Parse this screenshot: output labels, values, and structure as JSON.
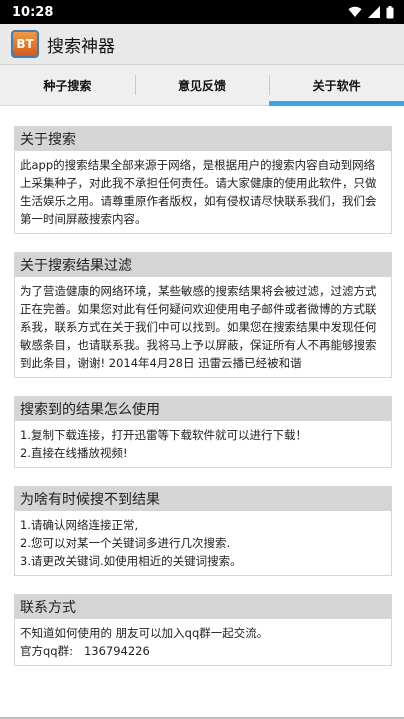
{
  "status_bar": {
    "time": "10:28"
  },
  "app_bar": {
    "icon_text": "BT",
    "title": "搜索神器"
  },
  "tabs": [
    {
      "label": "种子搜索",
      "active": false
    },
    {
      "label": "意见反馈",
      "active": false
    },
    {
      "label": "关于软件",
      "active": true
    }
  ],
  "accent_color": "#35a7e6",
  "sections": [
    {
      "title": "关于搜索",
      "body": "此app的搜索结果全部来源于网络，是根据用户的搜索内容自动到网络上采集种子，对此我不承担任何责任。请大家健康的使用此软件，只做生活娱乐之用。请尊重原作者版权，如有侵权请尽快联系我们，我们会第一时间屏蔽搜索内容。"
    },
    {
      "title": "关于搜索结果过滤",
      "body": "为了营造健康的网络环境，某些敏感的搜索结果将会被过滤，过滤方式正在完善。如果您对此有任何疑问欢迎使用电子邮件或者微博的方式联系我，联系方式在关于我们中可以找到。如果您在搜索结果中发现任何敏感条目，也请联系我。我将马上予以屏蔽，保证所有人不再能够搜索到此条目，谢谢! 2014年4月28日 迅雷云播已经被和谐"
    },
    {
      "title": "搜索到的结果怎么使用",
      "lines": [
        "1.复制下载连接，打开迅雷等下载软件就可以进行下载！",
        "2.直接在线播放视频!"
      ]
    },
    {
      "title": "为啥有时候搜不到结果",
      "lines": [
        "1.请确认网络连接正常,",
        "2.您可以对某一个关键词多进行几次搜索.",
        "3.请更改关键词.如使用相近的关键词搜索。"
      ]
    },
    {
      "title": "联系方式",
      "lines": [
        "不知道如何使用的 朋友可以加入qq群一起交流。",
        "官方qq群:   136794226"
      ]
    }
  ]
}
